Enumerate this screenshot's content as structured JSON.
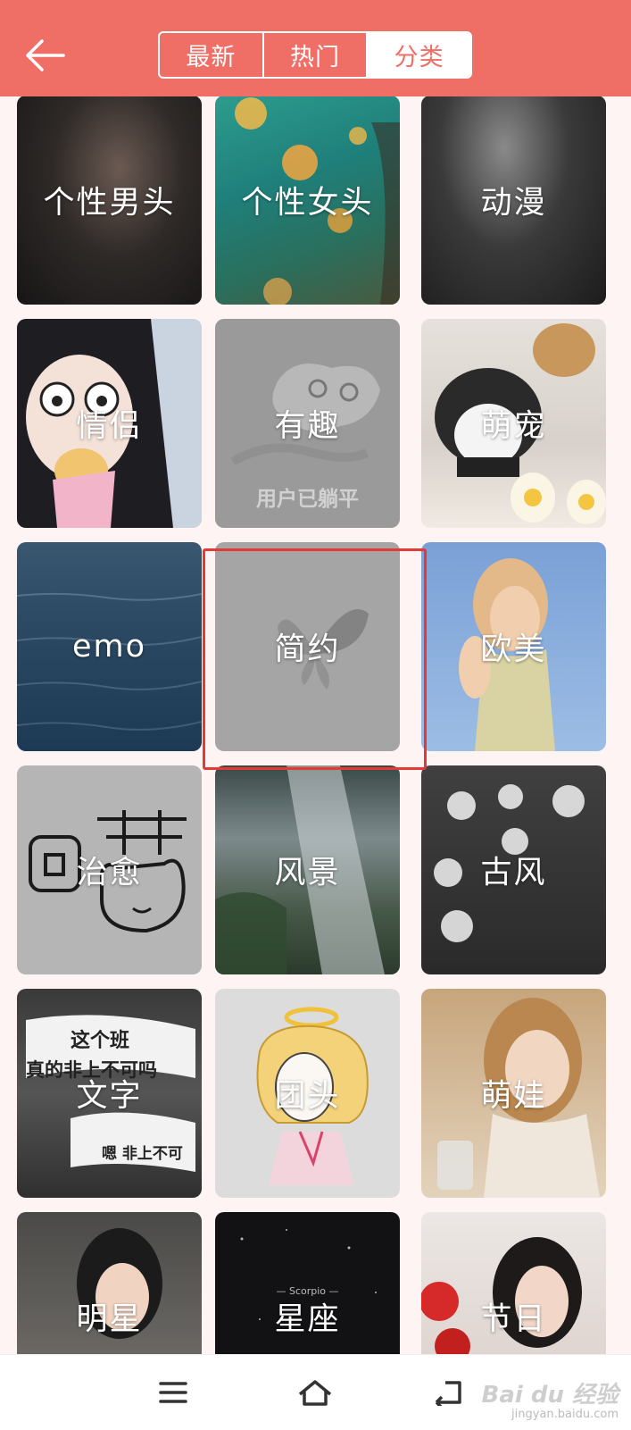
{
  "header": {
    "back_icon": "arrow-left-icon",
    "tabs": [
      {
        "label": "最新",
        "active": false
      },
      {
        "label": "热门",
        "active": false
      },
      {
        "label": "分类",
        "active": true
      }
    ],
    "color": "#ef6f66"
  },
  "categories": [
    {
      "label": "个性男头",
      "theme": "portrait-dark"
    },
    {
      "label": "个性女头",
      "theme": "jellyfish-teal"
    },
    {
      "label": "动漫",
      "theme": "anime-dark"
    },
    {
      "label": "情侣",
      "theme": "anime-girl"
    },
    {
      "label": "有趣",
      "theme": "gray-blob",
      "sub_text": "用户已躺平"
    },
    {
      "label": "萌宠",
      "theme": "cat-toys"
    },
    {
      "label": "emo",
      "theme": "ocean"
    },
    {
      "label": "简约",
      "theme": "gray-butterfly",
      "selected": true
    },
    {
      "label": "欧美",
      "theme": "blonde-sky"
    },
    {
      "label": "治愈",
      "theme": "doodle-gray"
    },
    {
      "label": "风景",
      "theme": "waterfall"
    },
    {
      "label": "古风",
      "theme": "rain-window"
    },
    {
      "label": "文字",
      "theme": "banner-text"
    },
    {
      "label": "团头",
      "theme": "cartoon-angel"
    },
    {
      "label": "萌娃",
      "theme": "child-portrait"
    },
    {
      "label": "明星",
      "theme": "celebrity"
    },
    {
      "label": "星座",
      "theme": "night-sky"
    },
    {
      "label": "节日",
      "theme": "roses"
    }
  ],
  "tile_text": {
    "banner_line1": "这个班",
    "banner_line2": "真的非上不可吗",
    "banner_line3": "嗯 非上不可",
    "scorpio": "— Scorpio —"
  },
  "navbar": {
    "menu_icon": "menu-icon",
    "home_icon": "home-icon",
    "back_icon": "return-icon"
  },
  "watermark": {
    "logo": "Bai du 经验",
    "url": "jingyan.baidu.com"
  }
}
